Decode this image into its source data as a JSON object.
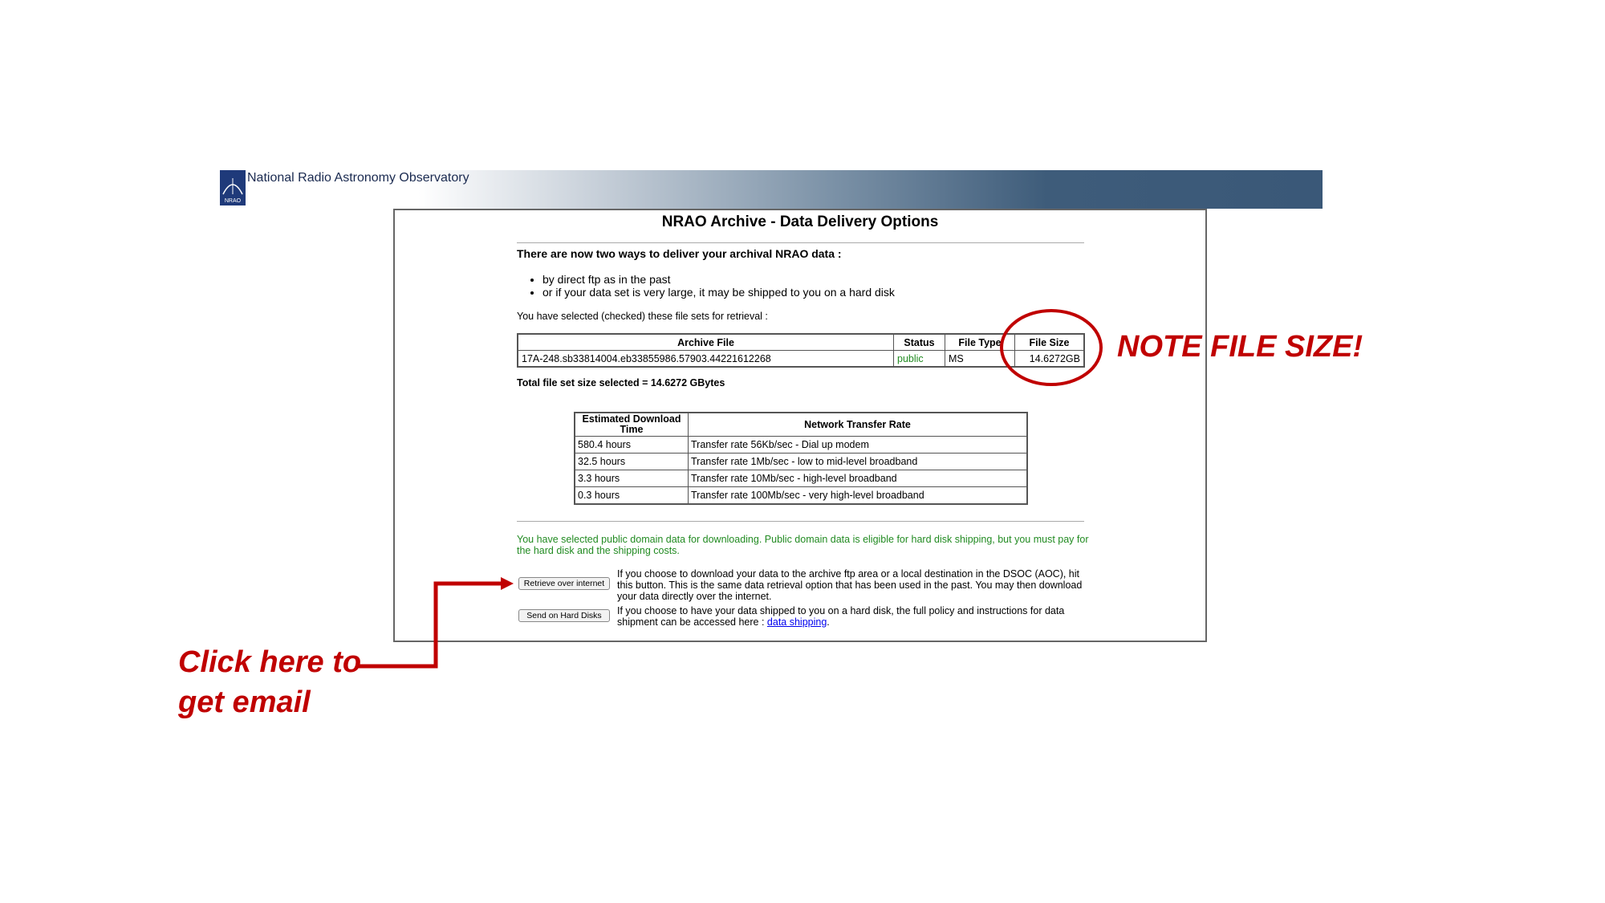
{
  "header": {
    "org_name": "National Radio Astronomy Observatory",
    "logo_text": "NRAO",
    "banner_colors": [
      "#ffffff",
      "#3a5878"
    ]
  },
  "page": {
    "title": "NRAO Archive - Data Delivery Options",
    "intro": "There are now two ways to deliver your archival NRAO data :",
    "options": [
      "by direct ftp as in the past",
      "or if your data set is very large, it may be shipped to you on a hard disk"
    ],
    "selected_text": "You have selected (checked) these file sets for retrieval :",
    "file_table": {
      "headers": [
        "Archive File",
        "Status",
        "File Type",
        "File Size"
      ],
      "rows": [
        [
          "17A-248.sb33814004.eb33855986.57903.44221612268",
          "public",
          "MS",
          "14.6272GB"
        ]
      ]
    },
    "total": "Total file set size selected = 14.6272 GBytes",
    "rate_table": {
      "headers": [
        "Estimated Download Time",
        "Network Transfer Rate"
      ],
      "rows": [
        [
          "580.4 hours",
          "Transfer rate 56Kb/sec - Dial up modem"
        ],
        [
          "32.5 hours",
          "Transfer rate 1Mb/sec - low to mid-level broadband"
        ],
        [
          "3.3 hours",
          "Transfer rate 10Mb/sec - high-level broadband"
        ],
        [
          "0.3 hours",
          "Transfer rate 100Mb/sec - very high-level broadband"
        ]
      ]
    },
    "public_note": "You have selected public domain data for downloading. Public domain data is eligible for hard disk shipping, but you must pay for the hard disk and the shipping costs.",
    "retrieve_button": "Retrieve over internet",
    "retrieve_text": "If you choose to download your data to the archive ftp area or a local destination in the DSOC (AOC), hit this button. This is the same data retrieval option that has been used in the past. You may then download your data directly over the internet.",
    "hard_disk_button": "Send on Hard Disks",
    "hard_disk_text": "If you choose to have your data shipped to you on a hard disk, the full policy and instructions for data shipment can be accessed here : ",
    "data_shipping_link": "data shipping",
    "hard_disk_text_end": "."
  },
  "annotations": {
    "note_label": "NOTE FILE SIZE!",
    "click_label_line1": "Click here to",
    "click_label_line2": "get email",
    "color": "#c00000"
  }
}
